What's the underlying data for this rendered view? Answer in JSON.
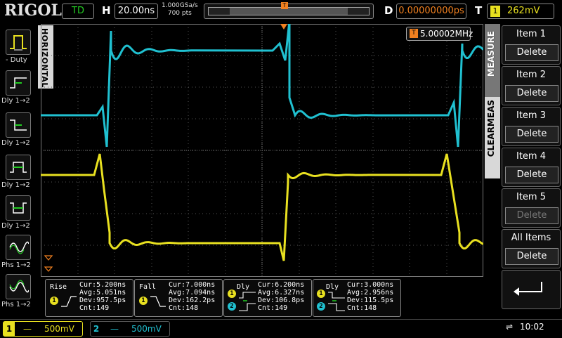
{
  "brand": "RIGOL",
  "header": {
    "run_state": "TD",
    "h_label": "H",
    "timebase": "20.00ns",
    "sample_rate": "1.000GSa/s",
    "mem_depth": "700 pts",
    "d_label": "D",
    "delay": "0.00000000ps",
    "t_label": "T",
    "trigger_channel": "1",
    "trigger_level": "262mV"
  },
  "left_panel": {
    "tab_title": "HORIZONTAL",
    "buttons": [
      {
        "label": "- Duty",
        "icon": "duty-cycle-icon"
      },
      {
        "label": "Dly 1→2",
        "icon": "delay-rise-rise-icon"
      },
      {
        "label": "Dly 1→2",
        "icon": "delay-fall-fall-icon"
      },
      {
        "label": "Dly 1→2",
        "icon": "delay-rise-fall-icon"
      },
      {
        "label": "Dly 1→2",
        "icon": "delay-fall-rise-icon"
      },
      {
        "label": "Phs 1→2",
        "icon": "phase-rise-icon"
      },
      {
        "label": "Phs 1→2",
        "icon": "phase-fall-icon"
      }
    ]
  },
  "counter": {
    "badge": "T",
    "value": "5.00002MHz"
  },
  "right_menu": {
    "tab_measure": "MEASURE",
    "tab_clear": "CLEARMEAS",
    "items": [
      {
        "title": "Item 1",
        "action": "Delete",
        "enabled": true
      },
      {
        "title": "Item 2",
        "action": "Delete",
        "enabled": true
      },
      {
        "title": "Item 3",
        "action": "Delete",
        "enabled": true
      },
      {
        "title": "Item 4",
        "action": "Delete",
        "enabled": true
      },
      {
        "title": "Item 5",
        "action": "Delete",
        "enabled": false
      },
      {
        "title": "All Items",
        "action": "Delete",
        "enabled": true
      }
    ]
  },
  "measurements": [
    {
      "name": "Rise",
      "source": "1",
      "cur": "Cur:5.200ns",
      "avg": "Avg:5.051ns",
      "dev": "Dev:957.5ps",
      "cnt": "Cnt:149"
    },
    {
      "name": "Fall",
      "source": "1",
      "cur": "Cur:7.000ns",
      "avg": "Avg:7.094ns",
      "dev": "Dev:162.2ps",
      "cnt": "Cnt:148"
    },
    {
      "name": "Dly",
      "source": "1→2",
      "cur": "Cur:6.200ns",
      "avg": "Avg:6.327ns",
      "dev": "Dev:106.8ps",
      "cnt": "Cnt:149"
    },
    {
      "name": "Dly",
      "source": "1→2",
      "cur": "Cur:3.000ns",
      "avg": "Avg:2.956ns",
      "dev": "Dev:115.5ps",
      "cnt": "Cnt:148"
    }
  ],
  "channels": [
    {
      "number": "1",
      "coupling": "—",
      "scale": "500mV",
      "color": "#e8e020"
    },
    {
      "number": "2",
      "coupling": "—",
      "scale": "500mV",
      "color": "#20c0d0"
    }
  ],
  "status": {
    "usb_icon": "usb-icon",
    "time": "10:02"
  },
  "colors": {
    "ch1": "#e8e020",
    "ch2": "#20c0d0",
    "accent": "#f08020"
  }
}
